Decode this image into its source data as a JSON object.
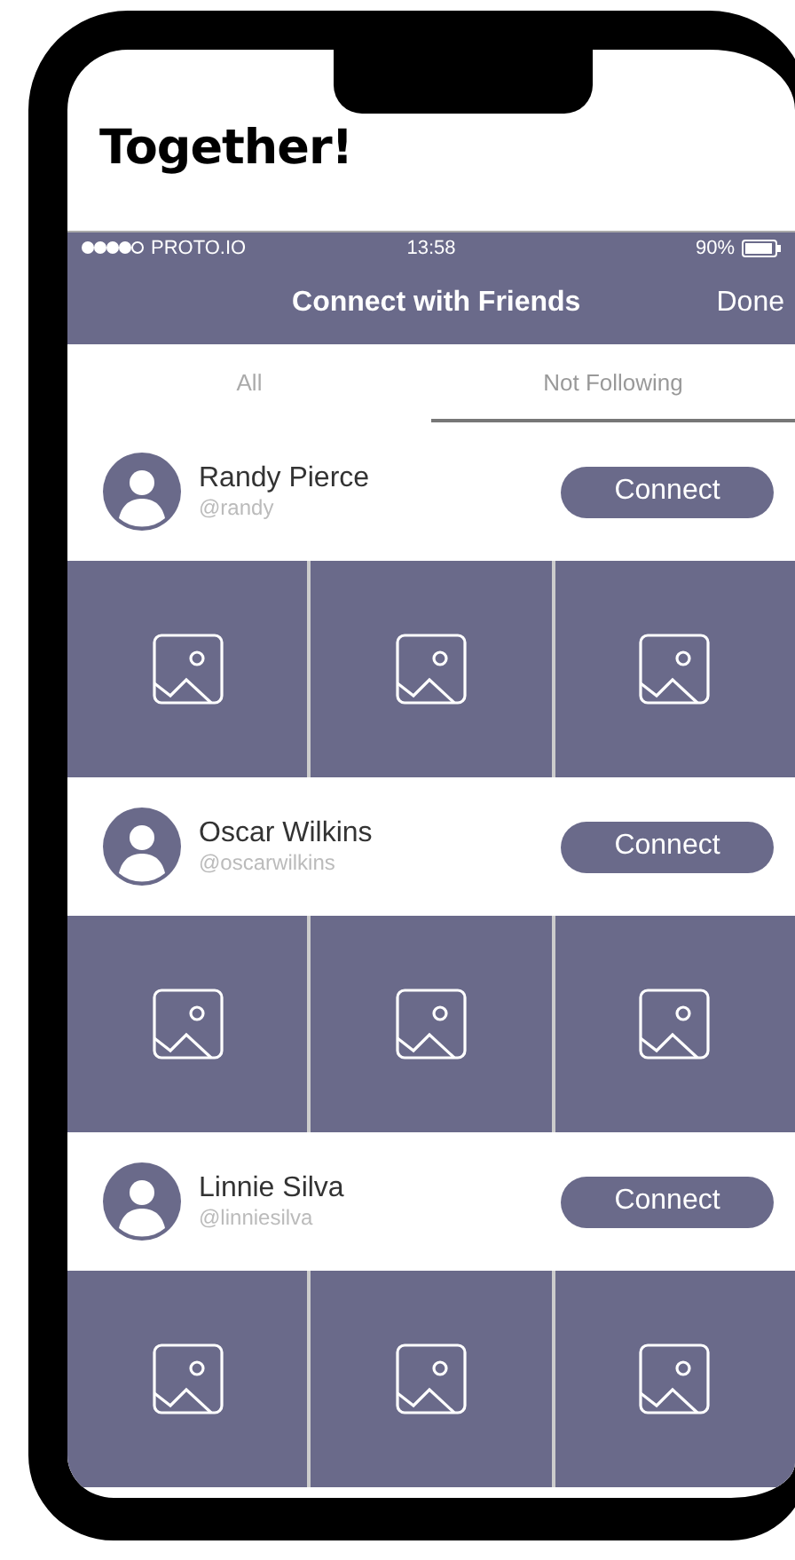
{
  "heading": "Together!",
  "status_bar": {
    "carrier": "PROTO.IO",
    "time": "13:58",
    "battery": "90%"
  },
  "nav_bar": {
    "title": "Connect with Friends",
    "action": "Done"
  },
  "tabs": [
    {
      "label": "All",
      "selected": false
    },
    {
      "label": "Not Following",
      "selected": true
    }
  ],
  "people": [
    {
      "name": "Randy Pierce",
      "handle": "@randy",
      "button": "Connect",
      "photos": [
        {
          "kind": "placeholder"
        },
        {
          "kind": "placeholder"
        },
        {
          "kind": "placeholder"
        }
      ]
    },
    {
      "name": "Oscar Wilkins",
      "handle": "@oscarwilkins",
      "button": "Connect",
      "photos": [
        {
          "kind": "placeholder"
        },
        {
          "kind": "placeholder"
        },
        {
          "kind": "placeholder"
        }
      ]
    },
    {
      "name": "Linnie Silva",
      "handle": "@linniesilva",
      "button": "Connect",
      "photos": [
        {
          "kind": "placeholder"
        },
        {
          "kind": "placeholder"
        },
        {
          "kind": "placeholder"
        }
      ]
    }
  ]
}
